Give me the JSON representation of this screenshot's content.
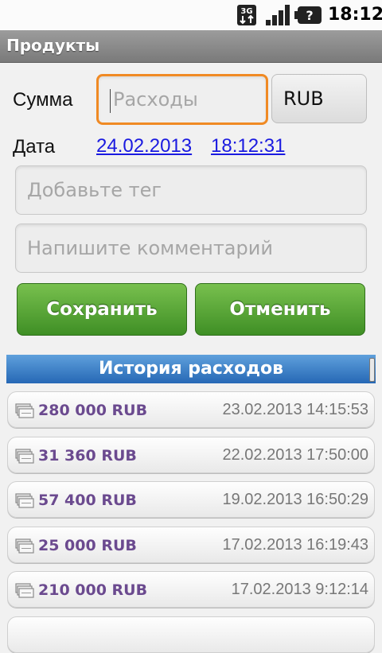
{
  "status_bar": {
    "network_icon": "3g-icon",
    "network_label": "3G",
    "signal_icon": "signal-icon",
    "battery_icon": "battery-unknown-icon",
    "battery_symbol": "?",
    "time": "18:12"
  },
  "title_bar": {
    "title": "Продукты"
  },
  "form": {
    "amount_label": "Сумма",
    "amount_placeholder": "Расходы",
    "currency": "RUB",
    "date_label": "Дата",
    "date_value": "24.02.2013",
    "time_value": "18:12:31",
    "tag_placeholder": "Добавьте тег",
    "comment_placeholder": "Напишите комментарий",
    "save_label": "Сохранить",
    "cancel_label": "Отменить"
  },
  "history": {
    "header": "История расходов",
    "item_icon": "money-icon",
    "items": [
      {
        "amount": "280 000 RUB",
        "datetime": "23.02.2013 14:15:53"
      },
      {
        "amount": "31 360 RUB",
        "datetime": "22.02.2013 17:50:00"
      },
      {
        "amount": "57 400 RUB",
        "datetime": "19.02.2013 16:50:29"
      },
      {
        "amount": "25 000 RUB",
        "datetime": "17.02.2013 16:19:43"
      },
      {
        "amount": "210 000 RUB",
        "datetime": "17.02.2013 9:12:14"
      }
    ]
  },
  "colors": {
    "accent_focus": "#f08a24",
    "button_green": "#4fa12f",
    "header_blue": "#2f72c0",
    "amount_purple": "#6b4a8f",
    "link_blue": "#1a1ae0"
  }
}
